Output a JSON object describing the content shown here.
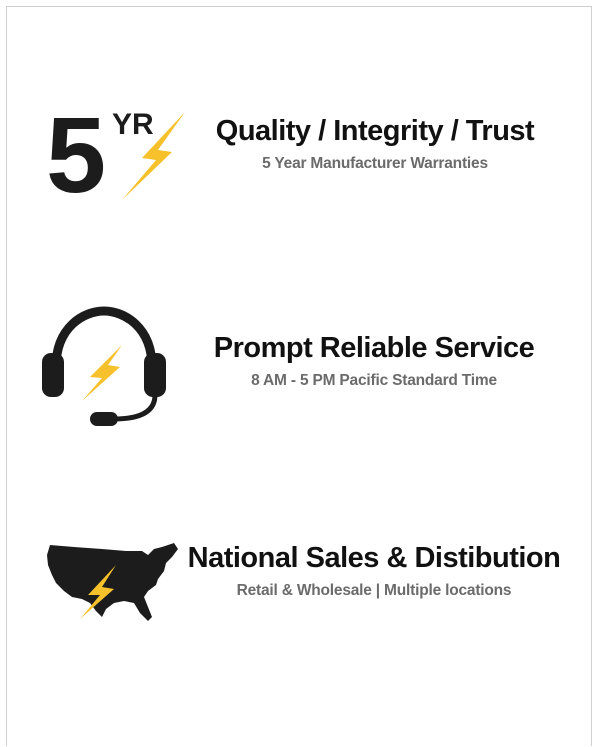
{
  "colors": {
    "bolt": "#f6c12a",
    "icon_dark": "#1c1c1c",
    "title": "#111111",
    "subtitle": "#6b6b6b",
    "border": "#cfcfcf"
  },
  "features": [
    {
      "icon": "warranty-5yr-bolt-icon",
      "icon_text": {
        "digit": "5",
        "unit": "YR"
      },
      "title": "Quality / Integrity / Trust",
      "subtitle": "5 Year Manufacturer Warranties"
    },
    {
      "icon": "headset-bolt-icon",
      "title": "Prompt Reliable Service",
      "subtitle": "8 AM - 5 PM Pacific Standard Time"
    },
    {
      "icon": "usa-map-bolt-icon",
      "title": "National Sales & Distibution",
      "subtitle": "Retail & Wholesale | Multiple locations"
    }
  ]
}
